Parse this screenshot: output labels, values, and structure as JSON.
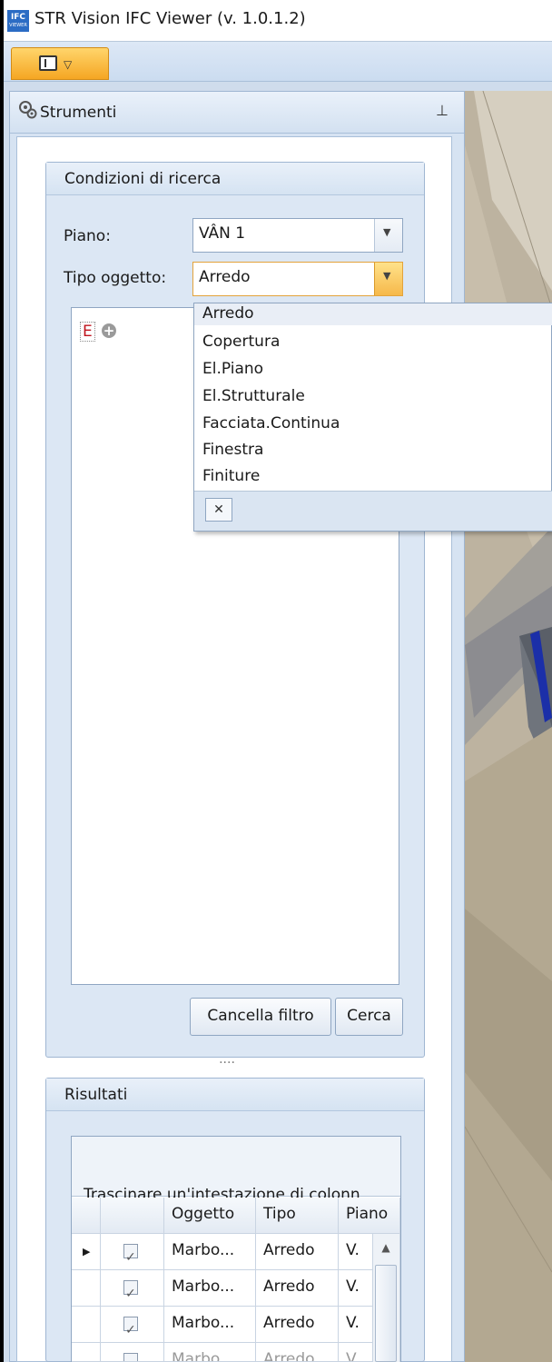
{
  "window": {
    "title": "STR Vision IFC Viewer (v. 1.0.1.2)",
    "icon_text_top": "IFC",
    "icon_text_bottom": "VIEWER"
  },
  "panel": {
    "title": "Strumenti"
  },
  "search": {
    "group_title": "Condizioni di ricerca",
    "piano_label": "Piano:",
    "piano_value": "VÂN 1",
    "tipo_label": "Tipo oggetto:",
    "tipo_value": "Arredo",
    "filter_token": "E",
    "cancel_label": "Cancella filtro",
    "search_label": "Cerca"
  },
  "dropdown": {
    "options": [
      "Arredo",
      "Copertura",
      "El.Piano",
      "El.Strutturale",
      "Facciata.Continua",
      "Finestra",
      "Finiture"
    ],
    "selected": "Arredo",
    "clear_symbol": "✕"
  },
  "results": {
    "group_title": "Risultati",
    "group_hint": "Trascinare un'intestazione di colonn",
    "columns": [
      "Oggetto",
      "Tipo",
      "Piano"
    ],
    "rows": [
      {
        "oggetto": "Marbo...",
        "tipo": "Arredo",
        "piano": "V."
      },
      {
        "oggetto": "Marbo...",
        "tipo": "Arredo",
        "piano": "V."
      },
      {
        "oggetto": "Marbo...",
        "tipo": "Arredo",
        "piano": "V."
      },
      {
        "oggetto": "Marbo...",
        "tipo": "Arredo",
        "piano": "V."
      }
    ]
  },
  "colors": {
    "accent_orange": "#f5a623",
    "panel_blue": "#d6e3f2",
    "filter_red": "#c0141d"
  }
}
